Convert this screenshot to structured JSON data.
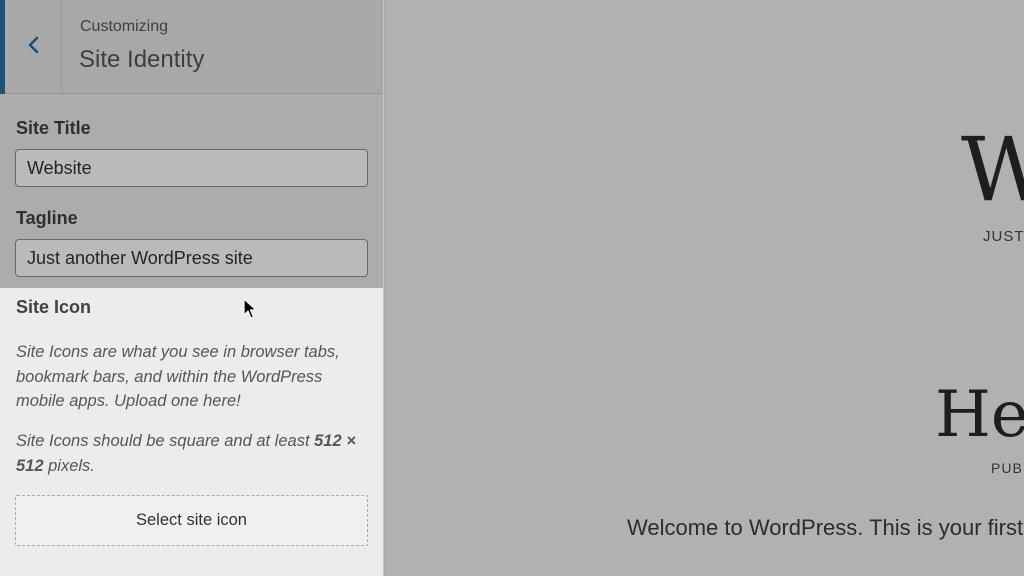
{
  "header": {
    "eyebrow": "Customizing",
    "title": "Site Identity",
    "back_icon": "chevron-left-icon",
    "accent_color": "#2271b1"
  },
  "site_title": {
    "label": "Site Title",
    "value": "Website"
  },
  "tagline": {
    "label": "Tagline",
    "value": "Just another WordPress site"
  },
  "site_icon": {
    "label": "Site Icon",
    "description": "Site Icons are what you see in browser tabs, bookmark bars, and within the WordPress mobile apps. Upload one here!",
    "size_note_prefix": "Site Icons should be square and at least ",
    "size_note_bold": "512 × 512",
    "size_note_suffix": " pixels.",
    "button_label": "Select site icon"
  },
  "preview": {
    "site_title": "W",
    "tagline": "JUST",
    "post_title": "Hel",
    "post_meta": "PUB",
    "post_excerpt": "Welcome to WordPress. This is your first"
  }
}
